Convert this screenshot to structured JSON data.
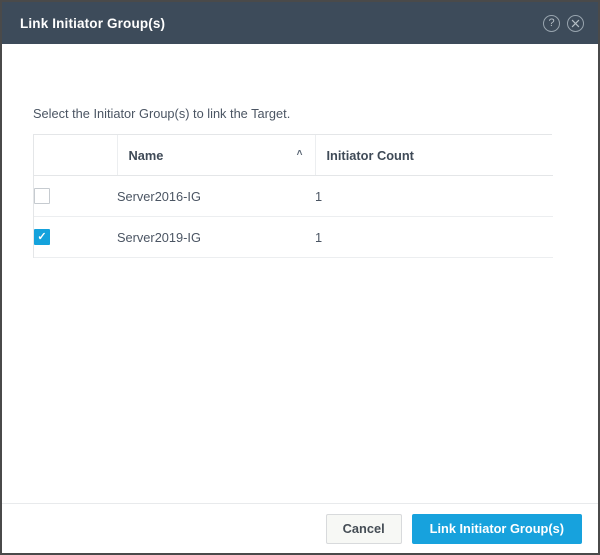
{
  "dialog": {
    "title": "Link Initiator Group(s)",
    "help_icon": "help-circle-icon",
    "close_icon": "close-circle-icon",
    "instruction": "Select the Initiator Group(s) to link the Target."
  },
  "table": {
    "columns": [
      {
        "key": "select",
        "label": ""
      },
      {
        "key": "name",
        "label": "Name",
        "sort": "asc",
        "sort_caret": "˄"
      },
      {
        "key": "initiator_count",
        "label": "Initiator Count"
      }
    ],
    "rows": [
      {
        "selected": false,
        "name": "Server2016-IG",
        "initiator_count": "1"
      },
      {
        "selected": true,
        "name": "Server2019-IG",
        "initiator_count": "1"
      }
    ]
  },
  "footer": {
    "cancel_label": "Cancel",
    "submit_label": "Link Initiator Group(s)"
  },
  "colors": {
    "titlebar_bg": "#3d4b5a",
    "accent": "#17a2dd",
    "checkbox_checked": "#14a2dc",
    "border": "#e4e6e8",
    "text": "#4b5563"
  }
}
